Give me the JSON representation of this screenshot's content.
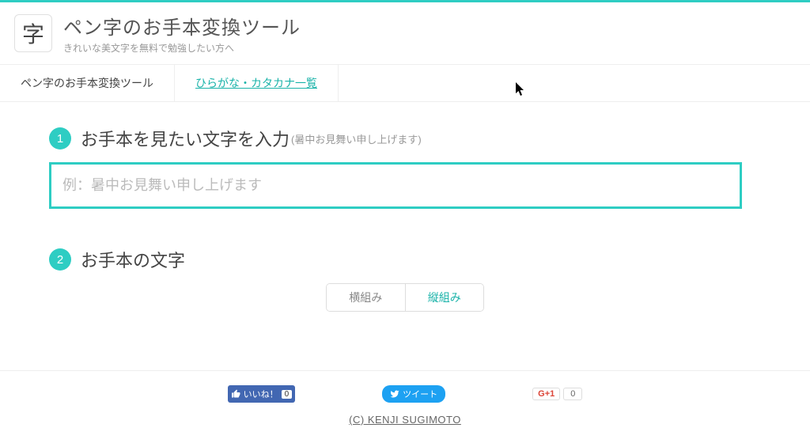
{
  "colors": {
    "accent": "#2ecdc3"
  },
  "header": {
    "logo_char": "字",
    "title": "ペン字のお手本変換ツール",
    "subtitle": "きれいな美文字を無料で勉強したい方へ"
  },
  "nav": {
    "tab_tool": "ペン字のお手本変換ツール",
    "tab_list": "ひらがな・カタカナ一覧"
  },
  "step1": {
    "badge": "1",
    "title": "お手本を見たい文字を入力",
    "hint": "(暑中お見舞い申し上げます)",
    "placeholder": "例：暑中お見舞い申し上げます",
    "value": ""
  },
  "step2": {
    "badge": "2",
    "title": "お手本の文字",
    "seg_horizontal": "横組み",
    "seg_vertical": "縦組み"
  },
  "social": {
    "fb_label": "いいね！",
    "fb_count": "0",
    "tw_label": "ツイート",
    "gp_label_g": "G",
    "gp_label_plus": "+1",
    "gp_count": "0"
  },
  "footer": {
    "copyright": "(C) KENJI SUGIMOTO"
  }
}
